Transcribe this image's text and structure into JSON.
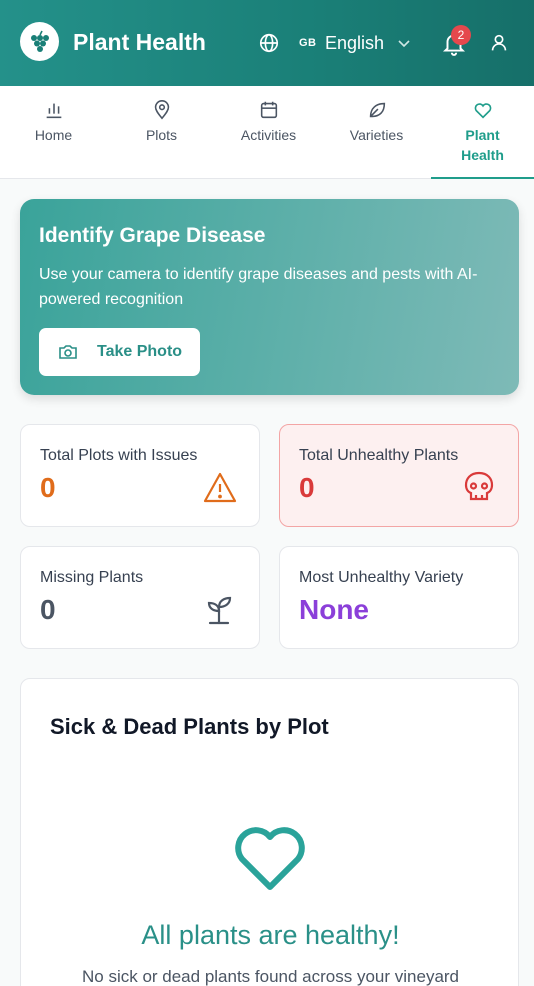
{
  "header": {
    "app_title": "Plant Health",
    "language_flag": "GB",
    "language_name": "English",
    "notification_count": "2",
    "logo_icon": "grape-icon",
    "colors": {
      "header_bg": "#1a7f77",
      "badge": "#e5484d"
    }
  },
  "tabs": [
    {
      "label": "Home",
      "icon": "bar-chart-icon",
      "active": false
    },
    {
      "label": "Plots",
      "icon": "map-pin-icon",
      "active": false
    },
    {
      "label": "Activities",
      "icon": "calendar-icon",
      "active": false
    },
    {
      "label": "Varieties",
      "icon": "leaf-icon",
      "active": false
    },
    {
      "label": "Plant Health",
      "icon": "heart-icon",
      "active": true
    }
  ],
  "hero": {
    "title": "Identify Grape Disease",
    "description": "Use your camera to identify grape diseases and pests with AI-powered recognition",
    "button_label": "Take Photo",
    "button_icon": "camera-icon"
  },
  "stats": {
    "plots_with_issues": {
      "label": "Total Plots with Issues",
      "value": "0",
      "icon": "warning-icon",
      "color": "#e06c1b"
    },
    "unhealthy_plants": {
      "label": "Total Unhealthy Plants",
      "value": "0",
      "icon": "skull-icon",
      "color": "#d93a3a"
    },
    "missing_plants": {
      "label": "Missing Plants",
      "value": "0",
      "icon": "sprout-icon",
      "color": "#4b5563"
    },
    "most_unhealthy_variety": {
      "label": "Most Unhealthy Variety",
      "value": "None",
      "color": "#8b3fd9"
    }
  },
  "chart_section": {
    "title": "Sick & Dead Plants by Plot",
    "empty_title": "All plants are healthy!",
    "empty_subtitle": "No sick or dead plants found across your vineyard"
  }
}
